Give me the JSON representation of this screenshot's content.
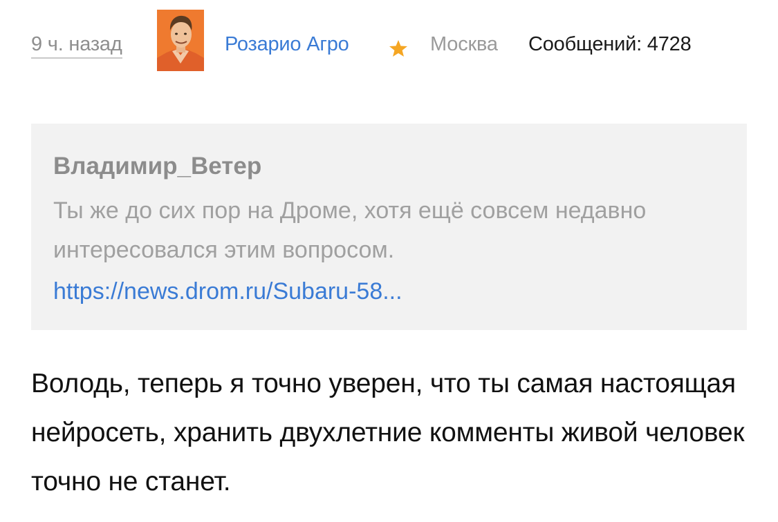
{
  "post": {
    "timestamp": "9 ч. назад",
    "author": "Розарио Агро",
    "city": "Москва",
    "posts_label": "Сообщений: 4728",
    "star_color": "#f5a623",
    "link_color": "#3a7bd5"
  },
  "quote": {
    "author": "Владимир_Ветер",
    "text": "Ты же до сих пор на Дроме, хотя ещё совсем недавно интересовался этим вопросом.",
    "link": "https://news.drom.ru/Subaru-58..."
  },
  "reply": {
    "text": "Володь, теперь я точно уверен, что ты самая настоящая нейросеть, хранить двухлетние комменты живой человек точно не станет."
  }
}
